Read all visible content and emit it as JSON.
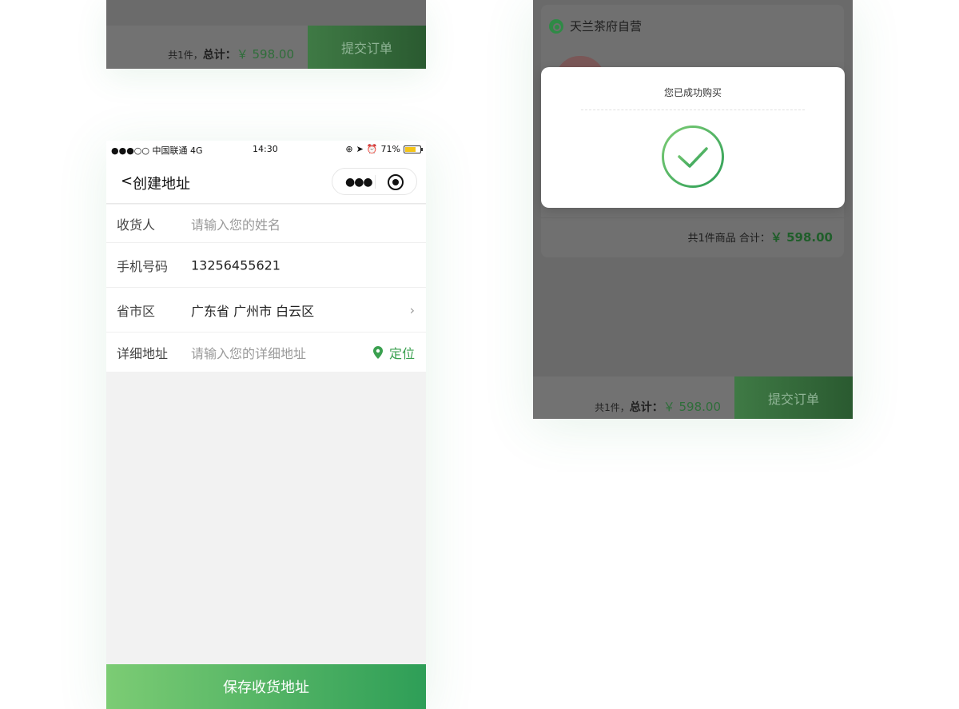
{
  "top_fragment": {
    "count_text": "共1件，",
    "total_label": "总计：",
    "total_price": "￥ 598.00",
    "submit_label": "提交订单"
  },
  "status_bar": {
    "carrier": "●●●○○ 中国联通  4G",
    "time": "14:30",
    "battery": "71%",
    "battery_level": 0.71
  },
  "nav": {
    "back": "<",
    "title": "创建地址"
  },
  "form": {
    "receiver": {
      "label": "收货人",
      "placeholder": "请输入您的姓名"
    },
    "phone": {
      "label": "手机号码",
      "value": "13256455621"
    },
    "region": {
      "label": "省市区",
      "value": "广东省  广州市  白云区"
    },
    "address": {
      "label": "详细地址",
      "placeholder": "请输入您的详细地址",
      "locate": "定位"
    }
  },
  "save_button": "保存收货地址",
  "order_screen": {
    "shop_name": "天兰茶府自营",
    "summary": "共1件商品   合计：",
    "summary_amount": "￥ 598.00",
    "count_text": "共1件，",
    "total_label": "总计：",
    "total_price": "￥ 598.00",
    "submit_label": "提交订单"
  },
  "modal": {
    "title": "您已成功购买"
  },
  "colors": {
    "accent": "#3aa04f",
    "gradient_start": "#7ccc74",
    "gradient_end": "#2e9e57"
  }
}
